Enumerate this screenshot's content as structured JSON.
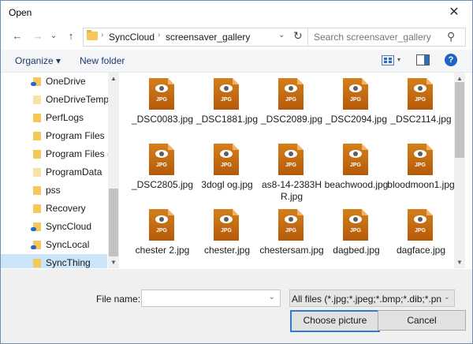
{
  "window": {
    "title": "Open",
    "close_glyph": "✕"
  },
  "nav": {
    "back_glyph": "←",
    "forward_glyph": "→",
    "recent_glyph": "⌄",
    "up_glyph": "↑",
    "breadcrumb": [
      "SyncCloud",
      "screensaver_gallery"
    ],
    "crumb_sep": "›",
    "address_dropdown_glyph": "⌄",
    "refresh_glyph": "↻",
    "search_placeholder": "Search screensaver_gallery",
    "search_glyph": "⚲"
  },
  "toolbar": {
    "organize_label": "Organize ▾",
    "new_folder_label": "New folder",
    "view_dropdown_glyph": "▾",
    "help_glyph": "?"
  },
  "sidebar": {
    "items": [
      {
        "label": "OneDrive",
        "icon": "cloud-folder-icon"
      },
      {
        "label": "OneDriveTemp",
        "icon": "folder-icon"
      },
      {
        "label": "PerfLogs",
        "icon": "folder-icon"
      },
      {
        "label": "Program Files",
        "icon": "folder-icon"
      },
      {
        "label": "Program Files (x",
        "icon": "folder-icon"
      },
      {
        "label": "ProgramData",
        "icon": "folder-icon"
      },
      {
        "label": "pss",
        "icon": "folder-icon"
      },
      {
        "label": "Recovery",
        "icon": "folder-icon"
      },
      {
        "label": "SyncCloud",
        "icon": "cloud-folder-icon"
      },
      {
        "label": "SyncLocal",
        "icon": "cloud-folder-icon"
      },
      {
        "label": "SyncThing",
        "icon": "folder-icon",
        "selected": true
      }
    ],
    "scroll_up_glyph": "▲",
    "scroll_down_glyph": "▼"
  },
  "files": {
    "items": [
      "_DSC0083.jpg",
      "_DSC1881.jpg",
      "_DSC2089.jpg",
      "_DSC2094.jpg",
      "_DSC2114.jpg",
      "_DSC2805.jpg",
      "3dogl og.jpg",
      "as8-14-2383HR.jpg",
      "beachwood.jpg",
      "bloodmoon1.jpg",
      "chester 2.jpg",
      "chester.jpg",
      "chestersam.jpg",
      "dagbed.jpg",
      "dagface.jpg"
    ],
    "type_label": "JPG",
    "scroll_up_glyph": "▲",
    "scroll_down_glyph": "▼"
  },
  "footer": {
    "file_name_label": "File name:",
    "file_name_value": "",
    "file_name_dropdown_glyph": "⌄",
    "filter_value": "All files (*.jpg;*.jpeg;*.bmp;*.dib;*.png",
    "filter_dropdown_glyph": "⌄",
    "choose_label": "Choose picture",
    "cancel_label": "Cancel"
  }
}
